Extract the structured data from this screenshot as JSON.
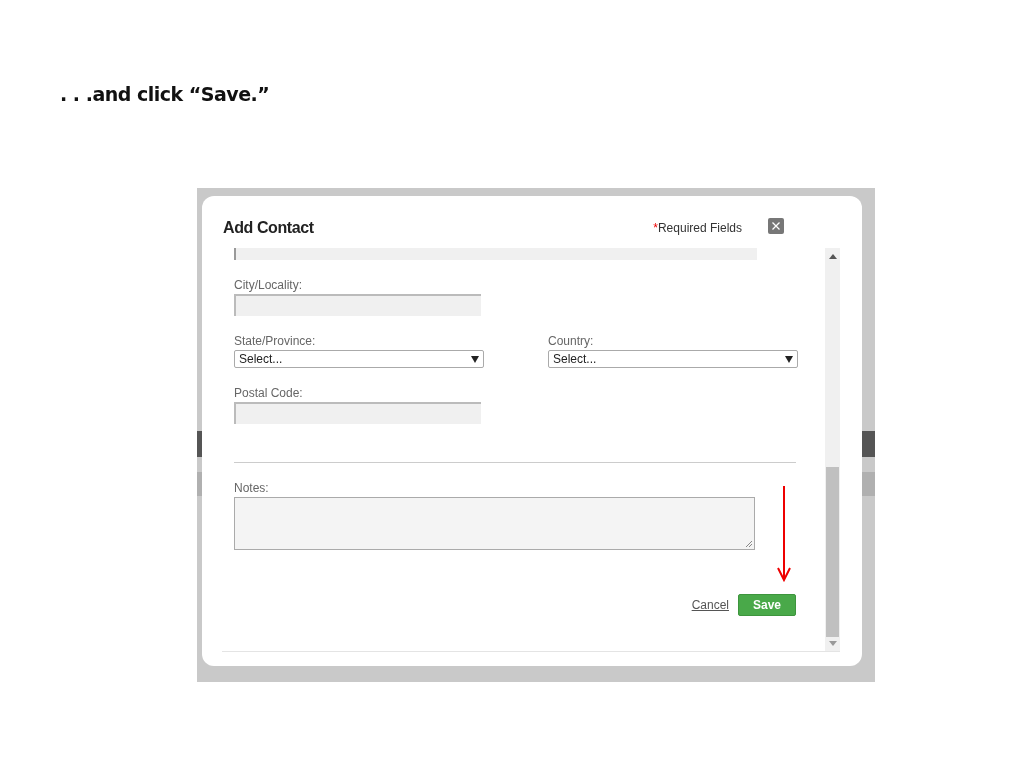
{
  "heading": ". . .and click “Save.”",
  "dialog": {
    "title": "Add Contact",
    "required_mark": "*",
    "required_text": "Required Fields",
    "rows": [
      [
        {
          "kind": "text",
          "label": "City/Locality:"
        }
      ],
      [
        {
          "kind": "select",
          "label": "State/Province:",
          "value": "Select..."
        },
        {
          "kind": "select",
          "label": "Country:",
          "value": "Select..."
        }
      ],
      [
        {
          "kind": "text",
          "label": "Postal Code:"
        }
      ],
      [
        {
          "kind": "divider"
        }
      ],
      [
        {
          "kind": "textarea",
          "label": "Notes:"
        }
      ]
    ],
    "cancel": "Cancel",
    "save": "Save",
    "annotation": {
      "kind": "arrow"
    }
  }
}
